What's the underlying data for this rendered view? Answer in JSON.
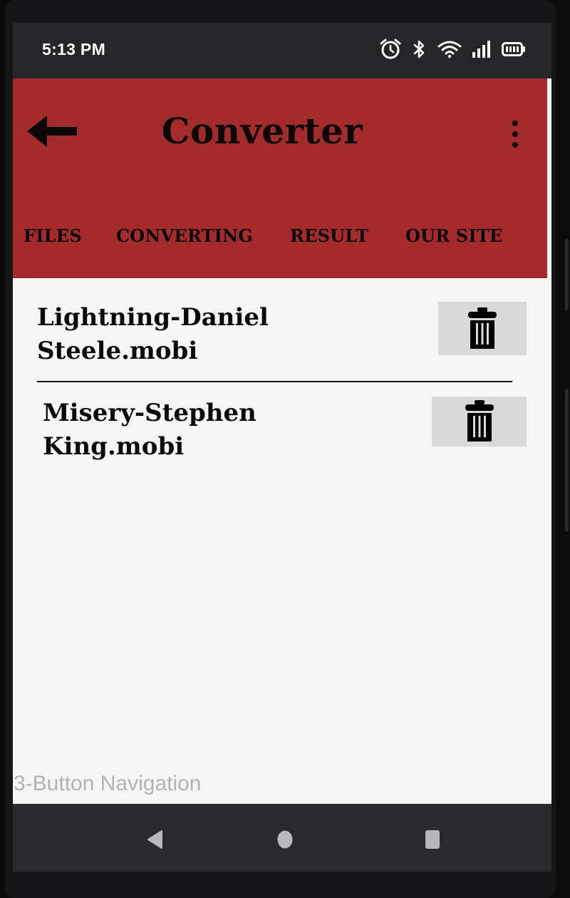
{
  "status_bar": {
    "time": "5:13 PM",
    "icons": [
      "alarm-icon",
      "bluetooth-icon",
      "wifi-icon",
      "signal-icon",
      "battery-icon"
    ]
  },
  "app_bar": {
    "title": "Converter",
    "background_color": "#a42b2c",
    "tabs": [
      {
        "label": "FILES"
      },
      {
        "label": "CONVERTING"
      },
      {
        "label": "RESULT"
      },
      {
        "label": "OUR SITE"
      }
    ]
  },
  "files": [
    {
      "name": "Lightning-Daniel Steele.mobi"
    },
    {
      "name": "Misery-Stephen King.mobi"
    }
  ],
  "navigation": {
    "hint": "3-Button Navigation",
    "buttons": [
      "back-icon",
      "home-icon",
      "recents-icon"
    ]
  }
}
